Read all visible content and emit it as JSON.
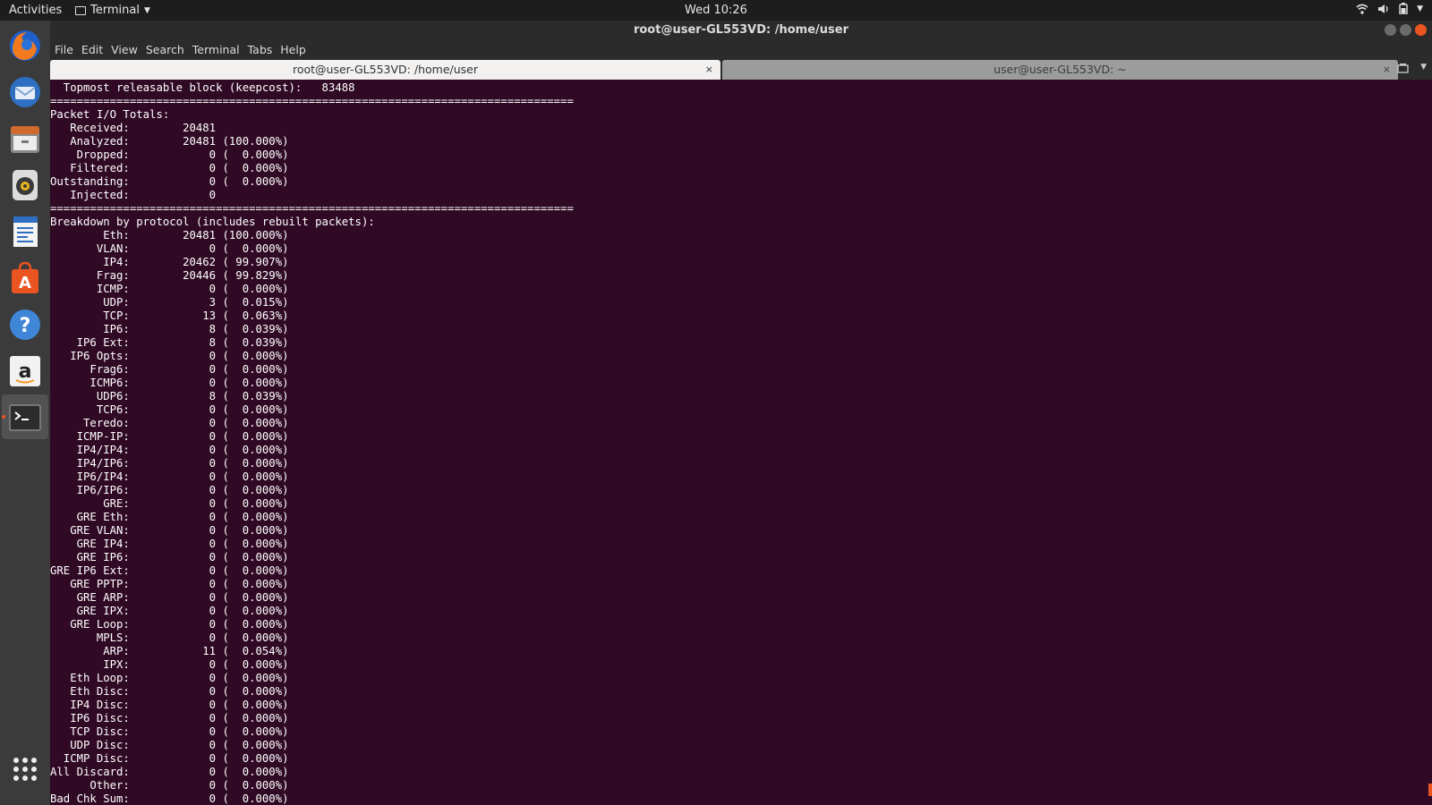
{
  "topbar": {
    "activities": "Activities",
    "app_menu": "Terminal",
    "clock": "Wed 10:26"
  },
  "dock": {
    "items": [
      "firefox-icon",
      "thunderbird-icon",
      "files-icon",
      "rhythmbox-icon",
      "libreoffice-writer-icon",
      "ubuntu-software-icon",
      "help-icon",
      "amazon-icon",
      "terminal-icon",
      "show-apps-icon"
    ],
    "accent": "#e95420"
  },
  "window": {
    "title": "root@user-GL553VD: /home/user"
  },
  "menu": [
    "File",
    "Edit",
    "View",
    "Search",
    "Terminal",
    "Tabs",
    "Help"
  ],
  "tabs": [
    {
      "label": "root@user-GL553VD: /home/user",
      "close": "×"
    },
    {
      "label": "user@user-GL553VD: ~",
      "close": "×"
    }
  ],
  "terminal": {
    "background": "#300a24",
    "lines": [
      "  Topmost releasable block (keepcost):   83488",
      "===============================================================================",
      "Packet I/O Totals:",
      "   Received:        20481",
      "   Analyzed:        20481 (100.000%)",
      "    Dropped:            0 (  0.000%)",
      "   Filtered:            0 (  0.000%)",
      "Outstanding:            0 (  0.000%)",
      "   Injected:            0",
      "===============================================================================",
      "Breakdown by protocol (includes rebuilt packets):",
      "        Eth:        20481 (100.000%)",
      "       VLAN:            0 (  0.000%)",
      "        IP4:        20462 ( 99.907%)",
      "       Frag:        20446 ( 99.829%)",
      "       ICMP:            0 (  0.000%)",
      "        UDP:            3 (  0.015%)",
      "        TCP:           13 (  0.063%)",
      "        IP6:            8 (  0.039%)",
      "    IP6 Ext:            8 (  0.039%)",
      "   IP6 Opts:            0 (  0.000%)",
      "      Frag6:            0 (  0.000%)",
      "      ICMP6:            0 (  0.000%)",
      "       UDP6:            8 (  0.039%)",
      "       TCP6:            0 (  0.000%)",
      "     Teredo:            0 (  0.000%)",
      "    ICMP-IP:            0 (  0.000%)",
      "    IP4/IP4:            0 (  0.000%)",
      "    IP4/IP6:            0 (  0.000%)",
      "    IP6/IP4:            0 (  0.000%)",
      "    IP6/IP6:            0 (  0.000%)",
      "        GRE:            0 (  0.000%)",
      "    GRE Eth:            0 (  0.000%)",
      "   GRE VLAN:            0 (  0.000%)",
      "    GRE IP4:            0 (  0.000%)",
      "    GRE IP6:            0 (  0.000%)",
      "GRE IP6 Ext:            0 (  0.000%)",
      "   GRE PPTP:            0 (  0.000%)",
      "    GRE ARP:            0 (  0.000%)",
      "    GRE IPX:            0 (  0.000%)",
      "   GRE Loop:            0 (  0.000%)",
      "       MPLS:            0 (  0.000%)",
      "        ARP:           11 (  0.054%)",
      "        IPX:            0 (  0.000%)",
      "   Eth Loop:            0 (  0.000%)",
      "   Eth Disc:            0 (  0.000%)",
      "   IP4 Disc:            0 (  0.000%)",
      "   IP6 Disc:            0 (  0.000%)",
      "   TCP Disc:            0 (  0.000%)",
      "   UDP Disc:            0 (  0.000%)",
      "  ICMP Disc:            0 (  0.000%)",
      "All Discard:            0 (  0.000%)",
      "      Other:            0 (  0.000%)",
      "Bad Chk Sum:            0 (  0.000%)"
    ]
  }
}
